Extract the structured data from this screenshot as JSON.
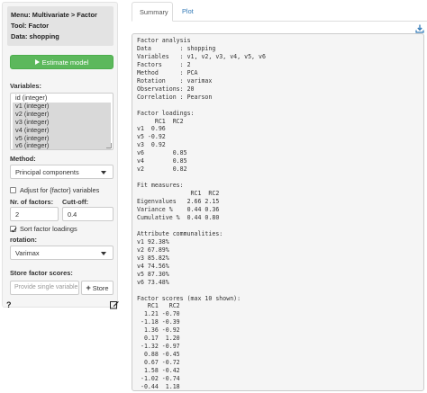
{
  "sidebar": {
    "info": {
      "menu": "Menu: Multivariate > Factor",
      "tool": "Tool: Factor",
      "data": "Data: shopping"
    },
    "estimate_button": "Estimate model",
    "variables_label": "Variables:",
    "variables": [
      {
        "label": "id (integer)",
        "selected": false
      },
      {
        "label": "v1 (integer)",
        "selected": true
      },
      {
        "label": "v2 (integer)",
        "selected": true
      },
      {
        "label": "v3 (integer)",
        "selected": true
      },
      {
        "label": "v4 (integer)",
        "selected": true
      },
      {
        "label": "v5 (integer)",
        "selected": true
      },
      {
        "label": "v6 (integer)",
        "selected": true
      }
    ],
    "method_label": "Method:",
    "method_value": "Principal components",
    "adjust_label": "Adjust for {factor} variables",
    "adjust_checked": false,
    "nr_factors_label": "Nr. of factors:",
    "nr_factors_value": "2",
    "cutoff_label": "Cutt-off:",
    "cutoff_value": "0.4",
    "sort_label": "Sort factor loadings",
    "sort_checked": true,
    "rotation_label": "rotation:",
    "rotation_value": "Varimax",
    "store_label": "Store factor scores:",
    "store_placeholder": "Provide single variable name",
    "store_button": "Store",
    "help_glyph": "?"
  },
  "tabs": [
    {
      "label": "Summary",
      "active": true
    },
    {
      "label": "Plot",
      "active": false
    }
  ],
  "output": {
    "text": "Factor analysis\nData        : shopping\nVariables   : v1, v2, v3, v4, v5, v6\nFactors     : 2\nMethod      : PCA\nRotation    : varimax\nObservations: 20\nCorrelation : Pearson\n\nFactor loadings:\n     RC1  RC2\nv1  0.96\nv5 -0.92\nv3  0.92\nv6        0.85\nv4        0.85\nv2        0.82\n\nFit measures:\n               RC1  RC2\nEigenvalues   2.66 2.15\nVariance %    0.44 0.36\nCumulative %  0.44 0.80\n\nAttribute communalities:\nv1 92.38%\nv2 67.89%\nv3 85.82%\nv4 74.56%\nv5 87.30%\nv6 73.48%\n\nFactor scores (max 10 shown):\n   RC1   RC2\n  1.21 -0.70\n -1.18 -0.39\n  1.36 -0.92\n  0.17  1.20\n -1.32 -0.97\n  0.88 -0.45\n  0.67 -0.72\n  1.58 -0.42\n -1.02 -0.74\n -0.44  1.18"
  },
  "colors": {
    "estimate_green": "#5cb85c",
    "link_blue": "#337ab7",
    "selected_gray": "#d9d9d9",
    "info_bg": "#e3e3e3"
  }
}
